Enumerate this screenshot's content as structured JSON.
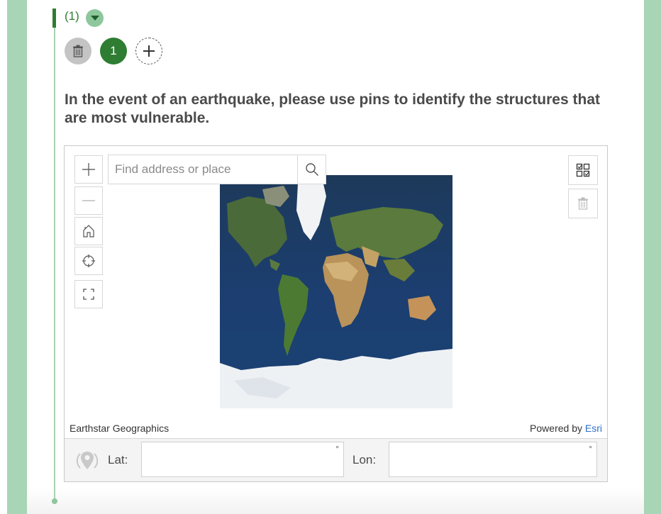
{
  "repeat": {
    "count_label": "(1)",
    "instance_number": "1"
  },
  "question": {
    "text": "In the event of an earthquake, please use pins to identify the structures that are most vulnerable."
  },
  "map": {
    "search": {
      "placeholder": "Find address or place"
    },
    "attribution": {
      "source": "Earthstar Geographics",
      "powered_by": "Powered by",
      "powered_by_link": "Esri"
    },
    "coordinates": {
      "lat_label": "Lat:",
      "lon_label": "Lon:",
      "lat_value": "",
      "lon_value": "",
      "degree_symbol": "°"
    }
  },
  "colors": {
    "accent": "#2e7d32",
    "side_band": "#a8d5b5",
    "link": "#2f6fc9"
  },
  "icons": [
    "chevron-down-icon",
    "trash-icon",
    "plus-icon",
    "zoom-in-icon",
    "zoom-out-icon",
    "home-icon",
    "locate-icon",
    "fullscreen-icon",
    "search-icon",
    "select-features-icon",
    "location-pin-icon"
  ]
}
